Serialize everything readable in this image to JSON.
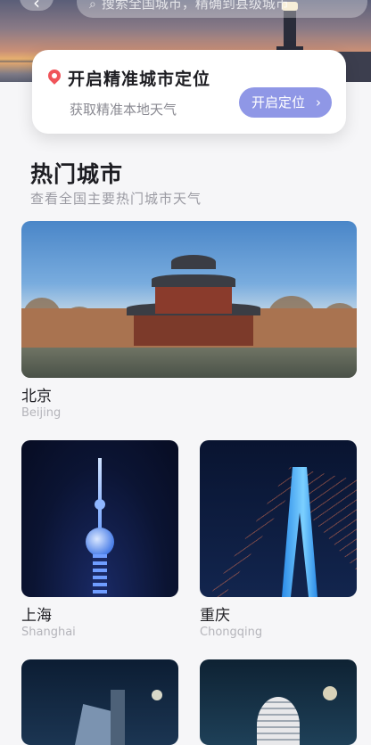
{
  "header": {
    "back_icon": "chevron-left-icon",
    "search_icon": "search-icon",
    "search_placeholder": "搜索全国城市，精确到县级城市"
  },
  "location_card": {
    "title": "开启精准城市定位",
    "subtitle": "获取精准本地天气",
    "button_label": "开启定位",
    "button_arrow": "›",
    "pin_color": "#f0545a",
    "button_color": "#8f97e6"
  },
  "hot_cities": {
    "title": "热门城市",
    "subtitle": "查看全国主要热门城市天气",
    "cities": [
      {
        "name": "北京",
        "en": "Beijing"
      },
      {
        "name": "上海",
        "en": "Shanghai"
      },
      {
        "name": "重庆",
        "en": "Chongqing"
      },
      {
        "name": "",
        "en": ""
      },
      {
        "name": "",
        "en": ""
      }
    ]
  }
}
